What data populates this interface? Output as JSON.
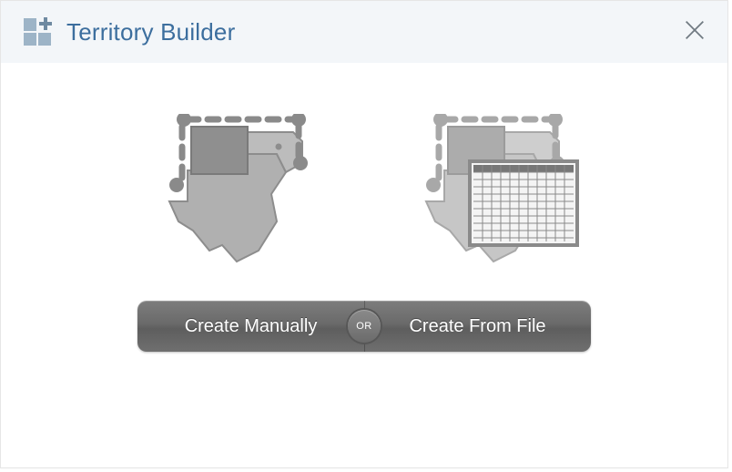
{
  "header": {
    "title": "Territory Builder"
  },
  "actions": {
    "create_manually": "Create Manually",
    "create_from_file": "Create From File",
    "or_label": "OR"
  },
  "icons": {
    "app_logo": "territory-builder-logo",
    "close": "close-icon",
    "manual_illustration": "territory-map-manual",
    "file_illustration": "territory-map-spreadsheet"
  }
}
